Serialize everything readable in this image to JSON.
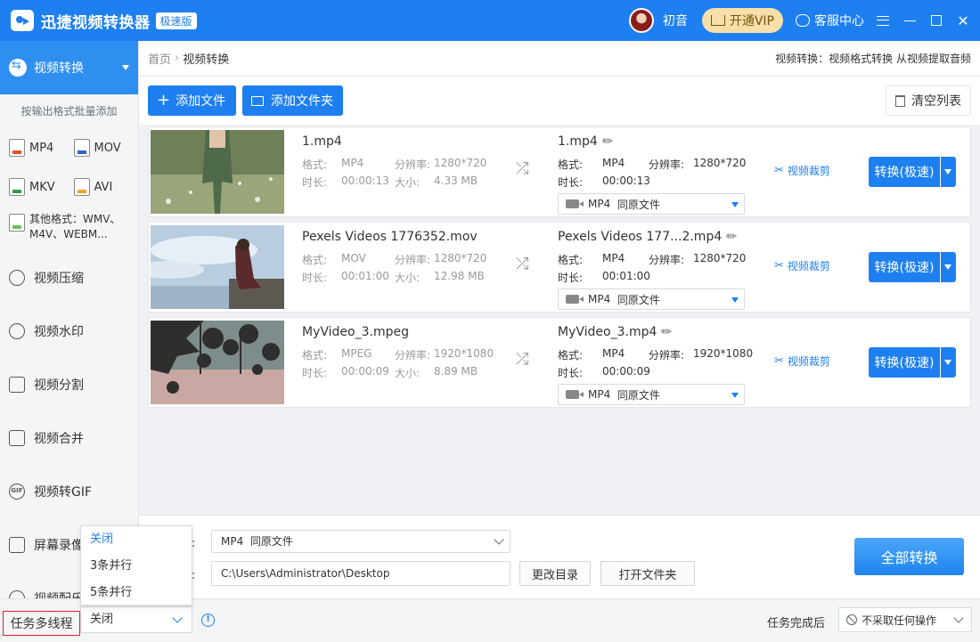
{
  "app": {
    "title": "迅捷视频转换器",
    "edition": "极速版"
  },
  "user": {
    "name": "初音",
    "vip_label": "开通VIP",
    "support_label": "客服中心"
  },
  "sidebar": {
    "active": {
      "label": "视频转换"
    },
    "hint": "按输出格式批量添加",
    "formats": [
      "MP4",
      "MOV",
      "MKV",
      "AVI"
    ],
    "other_formats": "其他格式：WMV、M4V、WEBM...",
    "items": [
      {
        "label": "视频压缩",
        "icon": "compress-icon"
      },
      {
        "label": "视频水印",
        "icon": "watermark-icon"
      },
      {
        "label": "视频分割",
        "icon": "split-icon"
      },
      {
        "label": "视频合并",
        "icon": "merge-icon"
      },
      {
        "label": "视频转GIF",
        "icon": "gif-icon"
      },
      {
        "label": "屏幕录像",
        "icon": "record-icon"
      },
      {
        "label": "视频配乐",
        "icon": "music-icon"
      }
    ]
  },
  "breadcrumb": {
    "home": "首页",
    "current": "视频转换",
    "description": "视频转换：视频格式转换 从视频提取音频"
  },
  "toolbar": {
    "add_file": "添加文件",
    "add_folder": "添加文件夹",
    "clear": "清空列表"
  },
  "labels": {
    "format": "格式:",
    "resolution": "分辨率:",
    "duration": "时长:",
    "size": "大小:",
    "cut": "视频裁剪",
    "convert": "转换(极速)",
    "same_as_source": "同原文件"
  },
  "files": [
    {
      "src_name": "1.mp4",
      "src_format": "MP4",
      "src_resolution": "1280*720",
      "src_duration": "00:00:13",
      "src_size": "4.33 MB",
      "dst_name": "1.mp4",
      "dst_format": "MP4",
      "dst_resolution": "1280*720",
      "dst_duration": "00:00:13",
      "dst_select": "MP4"
    },
    {
      "src_name": "Pexels Videos 1776352.mov",
      "src_format": "MOV",
      "src_resolution": "1280*720",
      "src_duration": "00:01:00",
      "src_size": "12.98 MB",
      "dst_name": "Pexels Videos 177...2.mp4",
      "dst_format": "MP4",
      "dst_resolution": "1280*720",
      "dst_duration": "00:01:00",
      "dst_select": "MP4"
    },
    {
      "src_name": "MyVideo_3.mpeg",
      "src_format": "MPEG",
      "src_resolution": "1920*1080",
      "src_duration": "00:00:09",
      "src_size": "8.89 MB",
      "dst_name": "MyVideo_3.mp4",
      "dst_format": "MP4",
      "dst_resolution": "1920*1080",
      "dst_duration": "00:00:09",
      "dst_select": "MP4"
    }
  ],
  "bottom": {
    "format_label_partial": "式:",
    "format_value": "MP4  同原文件",
    "path_label_partial": "径:",
    "path_value": "C:\\Users\\Administrator\\Desktop",
    "change_dir": "更改目录",
    "open_folder": "打开文件夹",
    "convert_all": "全部转换"
  },
  "status": {
    "thread_label": "任务多线程",
    "thread_value": "关闭",
    "thread_options": [
      "关闭",
      "3条并行",
      "5条并行"
    ],
    "done_label": "任务完成后",
    "done_value": "不采取任何操作"
  },
  "colors": {
    "brand": "#1e7ff0",
    "vip": "#f7dfa8",
    "highlight_border": "#e0242a"
  }
}
